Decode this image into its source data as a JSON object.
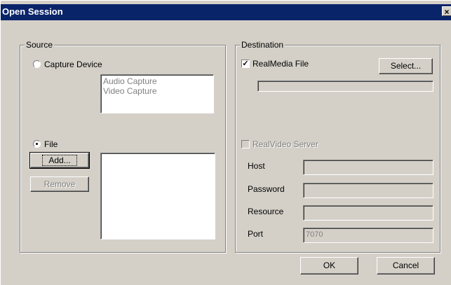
{
  "window": {
    "title": "Open Session",
    "close_glyph": "×"
  },
  "source": {
    "group_label": "Source",
    "capture_device_label": "Capture Device",
    "capture_devices": [
      "Audio Capture",
      "Video Capture"
    ],
    "file_label": "File",
    "add_label": "Add...",
    "remove_label": "Remove"
  },
  "destination": {
    "group_label": "Destination",
    "realmedia_label": "RealMedia File",
    "realmedia_check_glyph": "✓",
    "select_label": "Select...",
    "realvideo_label": "RealVideo Server",
    "host_label": "Host",
    "password_label": "Password",
    "resource_label": "Resource",
    "port_label": "Port",
    "port_value": "7070"
  },
  "footer": {
    "ok_label": "OK",
    "cancel_label": "Cancel"
  }
}
